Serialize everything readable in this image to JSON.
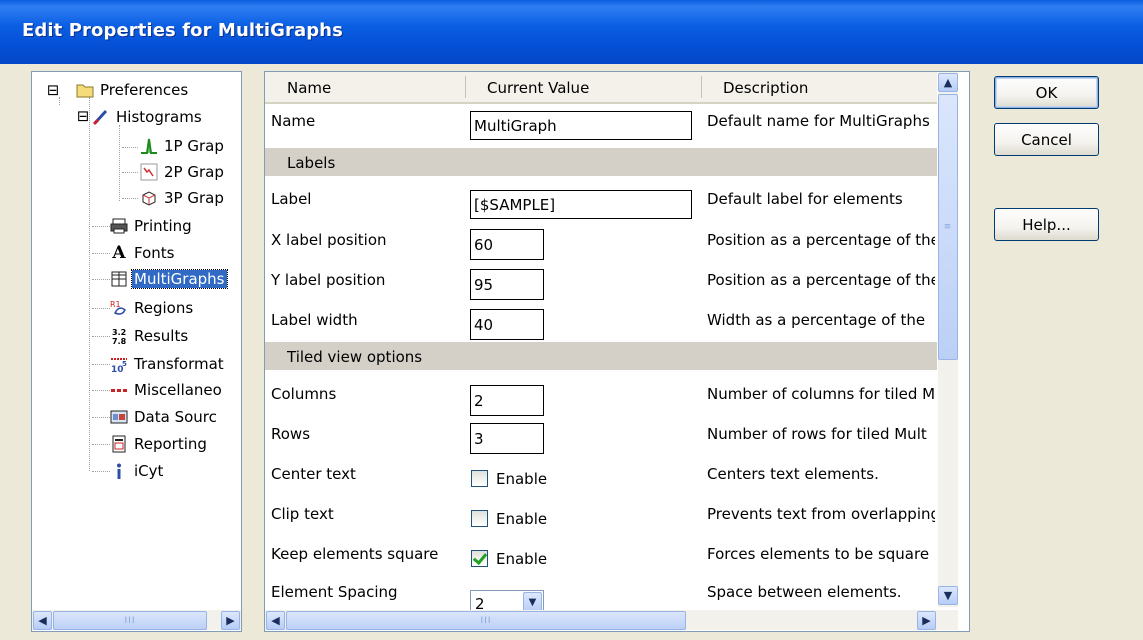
{
  "window": {
    "title": "Edit Properties for MultiGraphs"
  },
  "tree": {
    "items": [
      {
        "label": "Preferences",
        "icon": "folder-icon"
      },
      {
        "label": "Histograms",
        "icon": "histogram-brush-icon"
      },
      {
        "label": "1P Grap",
        "icon": "1p-graph-icon"
      },
      {
        "label": "2P Grap",
        "icon": "2p-graph-icon"
      },
      {
        "label": "3P Grap",
        "icon": "3p-graph-icon"
      },
      {
        "label": "Printing",
        "icon": "printer-icon"
      },
      {
        "label": "Fonts",
        "icon": "font-icon"
      },
      {
        "label": "MultiGraphs",
        "icon": "multigraphs-icon"
      },
      {
        "label": "Regions",
        "icon": "regions-icon"
      },
      {
        "label": "Results",
        "icon": "results-icon"
      },
      {
        "label": "Transformat",
        "icon": "transformation-icon"
      },
      {
        "label": "Miscellaneo",
        "icon": "miscellaneous-icon"
      },
      {
        "label": "Data Sourc",
        "icon": "data-source-icon"
      },
      {
        "label": "Reporting",
        "icon": "reporting-icon"
      },
      {
        "label": "iCyt",
        "icon": "info-icon"
      }
    ],
    "selected": "MultiGraphs",
    "expander_minus": "⊟",
    "font_glyph": "A"
  },
  "grid": {
    "headers": {
      "name": "Name",
      "value": "Current Value",
      "description": "Description"
    },
    "rows": {
      "name": {
        "name": "Name",
        "value": "MultiGraph",
        "description": "Default name for MultiGraphs"
      },
      "labels_section": "Labels",
      "label": {
        "name": "Label",
        "value": "[$SAMPLE]",
        "description": "Default label for elements"
      },
      "x_label_position": {
        "name": "X label position",
        "value": "60",
        "description": "Position as a percentage of the"
      },
      "y_label_position": {
        "name": "Y label position",
        "value": "95",
        "description": "Position as a percentage of the"
      },
      "label_width": {
        "name": "Label width",
        "value": "40",
        "description": "Width as a percentage of the"
      },
      "tiled_section": "Tiled view options",
      "columns": {
        "name": "Columns",
        "value": "2",
        "description": "Number of columns for tiled M"
      },
      "rows": {
        "name": "Rows",
        "value": "3",
        "description": "Number of rows for tiled Mult"
      },
      "center_text": {
        "name": "Center text",
        "checkbox_label": "Enable",
        "checked": false,
        "description": "Centers text elements."
      },
      "clip_text": {
        "name": "Clip text",
        "checkbox_label": "Enable",
        "checked": false,
        "description": "Prevents text from overlapping"
      },
      "keep_square": {
        "name": "Keep elements square",
        "checkbox_label": "Enable",
        "checked": true,
        "description": "Forces elements to be square"
      },
      "element_spacing": {
        "name": "Element Spacing",
        "value": "2",
        "description": "Space between elements."
      }
    }
  },
  "buttons": {
    "ok": "OK",
    "cancel": "Cancel",
    "help": "Help..."
  },
  "scroll_glyphs": {
    "up": "▲",
    "down": "▼",
    "left": "◀",
    "right": "▶",
    "grip": "≡",
    "grip_h": "III",
    "combo": "▼"
  }
}
